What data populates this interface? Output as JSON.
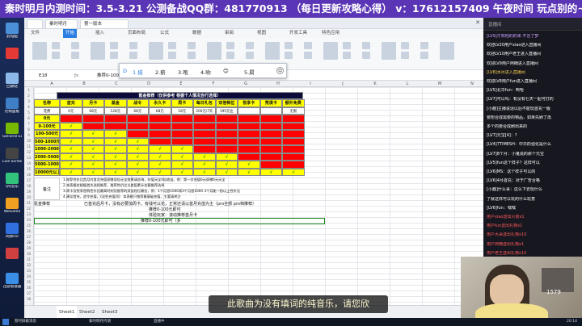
{
  "banner": {
    "text": "秦时明月内测时间：3.5-3.21 公测备战QQ群：481770913 （每日更新攻略心得） v：17612157409 午夜时间 玩点别的~"
  },
  "desktop": {
    "icons": [
      {
        "label": "此电脑",
        "color": "#4a90d9"
      },
      {
        "label": "",
        "color": "#e53935"
      },
      {
        "label": "回收站",
        "color": "#8bb8e8"
      },
      {
        "label": "控制面板",
        "color": "#3f7fc6"
      },
      {
        "label": "GeForce Experience",
        "color": "#76b900"
      },
      {
        "label": "Live Screen Capture",
        "color": "#444"
      },
      {
        "label": "QQ音乐",
        "color": "#31c27c"
      },
      {
        "label": "WeGame",
        "color": "#f0a020"
      },
      {
        "label": "网易UU",
        "color": "#2f6fde"
      },
      {
        "label": "",
        "color": "#d04040"
      },
      {
        "label": "迅游加速器",
        "color": "#3a8ee6"
      }
    ]
  },
  "excel": {
    "tabs": [
      "",
      "秦时明月",
      "第一版本",
      "WPS"
    ],
    "menu": [
      "文件",
      "开始",
      "插入",
      "页面布局",
      "公式",
      "数据",
      "审阅",
      "视图",
      "开发工具",
      "特色应用"
    ],
    "name_box": "E18",
    "formula": "推荐0-100元即可（多",
    "ime": {
      "candidates": [
        "1.摇",
        "2.薪",
        "3.咆",
        "4.哟"
      ],
      "emoji": "😊",
      "more": "5.屙"
    },
    "table": {
      "title": "氪金推荐（仅供参考 根据个人情况自行选择）",
      "headers": [
        "名称",
        "首充",
        "月卡",
        "基金",
        "战令",
        "永久卡",
        "周卡",
        "每日礼包",
        "双倍档位",
        "悦享卡",
        "荒漠卡",
        "额外免费"
      ],
      "prices": [
        "花费",
        "6元",
        "68元",
        "128元",
        "68元",
        "68元",
        "18元",
        "200元/7天",
        "195元左",
        "",
        "",
        "无限"
      ],
      "rows": [
        {
          "label": "0元",
          "cells": [
            "r",
            "r",
            "r",
            "r",
            "r",
            "r",
            "r",
            "r",
            "r",
            "r",
            "r"
          ]
        },
        {
          "label": "0-100元",
          "cells": [
            "√",
            "r",
            "r",
            "r",
            "r",
            "r",
            "r",
            "r",
            "r",
            "r",
            "r"
          ]
        },
        {
          "label": "100-500元",
          "cells": [
            "√",
            "√",
            "√",
            "r",
            "r",
            "r",
            "r",
            "r",
            "r",
            "r",
            "r"
          ]
        },
        {
          "label": "500-1000元",
          "cells": [
            "√",
            "√",
            "√",
            "√",
            "r",
            "r",
            "r",
            "r",
            "r",
            "r",
            "r"
          ]
        },
        {
          "label": "1000-2000元",
          "cells": [
            "√",
            "√",
            "√",
            "√",
            "√",
            "√",
            "r",
            "r",
            "r",
            "r",
            "r"
          ]
        },
        {
          "label": "2000-5000元",
          "cells": [
            "√",
            "√",
            "√",
            "√",
            "√",
            "√",
            "√",
            "√",
            "r",
            "r",
            "r"
          ]
        },
        {
          "label": "5000-10000元",
          "cells": [
            "√",
            "√",
            "√",
            "√",
            "√",
            "√",
            "√",
            "√",
            "√",
            "r",
            "r"
          ]
        },
        {
          "label": "10000元以上",
          "cells": [
            "√",
            "√",
            "√",
            "√",
            "√",
            "√",
            "√",
            "√",
            "√",
            "√",
            "√"
          ]
        }
      ],
      "notes_label": "备注",
      "notes": [
        "1.推荐性价比首月内首次充值获赠双倍元宝效果请咨询，价值元宝4倍收益。例：第一次充值6元获赠6元元宝",
        "2.本表格仅根据首次选择推荐，推荐性价比以首配累计金额推荐选择",
        "3.周卡及悦享首购性价比最高时刻及推荐的双倍档位最佳，例：1个月首1000表3个月首1000 3个月能一档以上性价比",
        "4.建议首充，战令充值，《这些充值项》 本表格只推荐最基础充值，主要请关注"
      ],
      "tips_label": "氪金推荐",
      "tips": [
        "已首充后月卡，没有必要加周卡，有钱可以花，正常还请以首月充值为主（pro全部 pro档推荐）",
        "推荐0-100元即可",
        "体验玩家：滚动推荐首月卡",
        "推荐0-100元即可（多"
      ]
    },
    "sheet_tabs": [
      "Sheet1",
      "Sheet2",
      "Sheet3"
    ]
  },
  "taskbar": {
    "items": [
      "暂时屏蔽消息",
      "秦时明月内测",
      "直播中"
    ],
    "time": "20:14"
  },
  "chat": {
    "header": "直播间",
    "messages": [
      {
        "text": "[LV9]才知他的的来 不言了梦",
        "color": "#c9a0ff"
      },
      {
        "text": "欢迎LV20用户xiao进入直播间",
        "color": "#ffffff"
      },
      {
        "text": "欢迎LV10用户老王进入直播间",
        "color": "#ffffff"
      },
      {
        "text": "欢迎LV9用户阿楠进入直播间",
        "color": "#ffffff"
      },
      {
        "text": "[LV8]水月进入直播间",
        "color": "#ffd54f"
      },
      {
        "text": "欢迎LV8用户fun进入直播间",
        "color": "#ffffff"
      },
      {
        "text": "[LV5]北华fun：啊哈",
        "color": "#ffffff"
      },
      {
        "text": "[LV7]可以吗：有没有七天一起可打的",
        "color": "#ffffff"
      },
      {
        "text": "[小趣]主播说话以后不能玩首充一版",
        "color": "#ffffff"
      },
      {
        "text": "要想合成需要的物品，如果先刷了再",
        "color": "#ffffff"
      },
      {
        "text": "多个的要合成刷出来的",
        "color": "#ffffff"
      },
      {
        "text": "[LV7]元宝[4]：?",
        "color": "#ffffff"
      },
      {
        "text": "[LV4]7TIMESH：中华的强化是什么",
        "color": "#ffffff"
      },
      {
        "text": "[LV7]8个月：小鬼说的那个元宝",
        "color": "#ffffff"
      },
      {
        "text": "[LV5]fun这个样子？这样可以",
        "color": "#ffffff"
      },
      {
        "text": "[LV6]MS：这个样子可以的",
        "color": "#ffffff"
      },
      {
        "text": "[LV6]4月首充：对于广告合格",
        "color": "#ffffff"
      },
      {
        "text": "[小趣]什么事：这么下去玩什么",
        "color": "#ffffff"
      },
      {
        "text": "了就这样可以玩的什么玩意",
        "color": "#ffffff"
      },
      {
        "text": "[LV6]fun：嘿嘿",
        "color": "#ffffff"
      },
      {
        "text": "用户xiao送出火箭x1",
        "color": "#ff5b5b"
      },
      {
        "text": "用户fun送出礼物x1",
        "color": "#ff5b5b"
      },
      {
        "text": "用户大哥送出礼物x10",
        "color": "#ff5b5b"
      },
      {
        "text": "用户阿楠送出礼物x1",
        "color": "#ff5b5b"
      },
      {
        "text": "用户老王送出礼物x10",
        "color": "#ff5b5b"
      },
      {
        "text": "用户某人送出礼物x1",
        "color": "#ff5b5b"
      },
      {
        "text": "用户大哥送出礼物x10",
        "color": "#ff5b5b"
      },
      {
        "text": "用户xiao送出礼物x10",
        "color": "#ff5b5b"
      }
    ]
  },
  "lyric": {
    "text": "此歌曲为没有填词的纯音乐，请您欣"
  },
  "cam": {
    "counter": "1579"
  },
  "colors": {
    "red": "#ff0000",
    "yellow": "#ffff00",
    "banner": "#5a35b5"
  }
}
